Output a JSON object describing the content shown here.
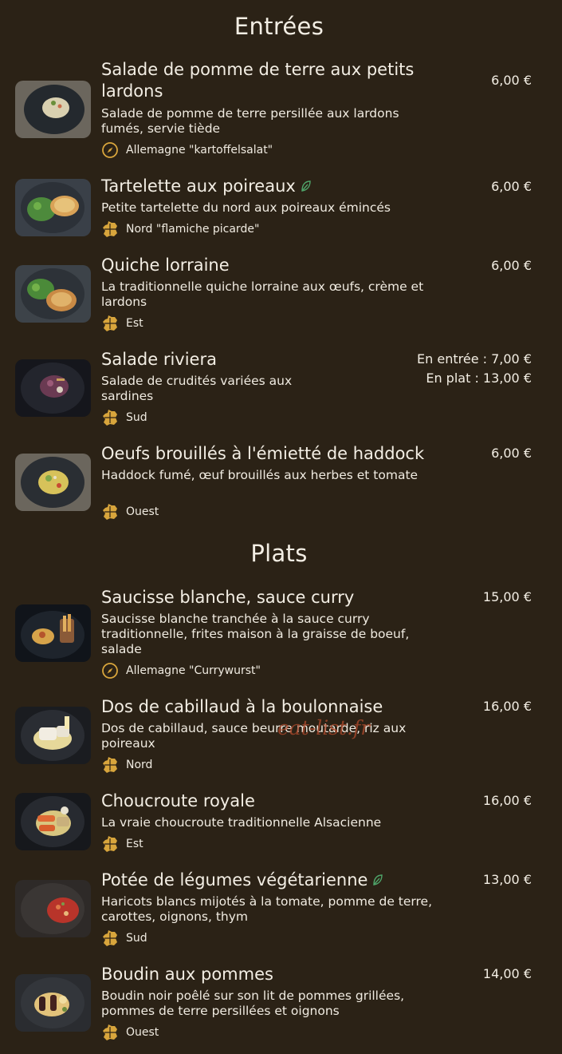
{
  "sections": [
    {
      "title": "Entrées",
      "items": [
        {
          "name": "Salade de pomme de terre aux petits lardons",
          "description": "Salade de pomme de terre persillée aux lardons fumés, servie tiède",
          "origin": "Allemagne \"kartoffelsalat\"",
          "origin_icon": "compass-icon",
          "price": "6,00 €"
        },
        {
          "name": "Tartelette aux poireaux",
          "vegetarian": true,
          "description": "Petite tartelette du nord aux poireaux émincés",
          "origin": "Nord  \"flamiche picarde\"",
          "origin_icon": "france-map-icon",
          "price": "6,00 €"
        },
        {
          "name": "Quiche lorraine",
          "description": "La traditionnelle quiche lorraine aux œufs, crème et lardons",
          "origin": "Est",
          "origin_icon": "france-map-icon",
          "price": "6,00 €"
        },
        {
          "name": "Salade riviera",
          "description": "Salade de crudités variées aux sardines",
          "origin": "Sud",
          "origin_icon": "france-map-icon",
          "prices": [
            "En entrée :  7,00 €",
            "En plat : 13,00 €"
          ]
        },
        {
          "name": "Oeufs brouillés à l'émietté de haddock",
          "description": "Haddock fumé, œuf brouillés aux herbes et tomate",
          "origin": "Ouest",
          "origin_icon": "france-map-icon",
          "price": "6,00 €"
        }
      ]
    },
    {
      "title": "Plats",
      "items": [
        {
          "name": "Saucisse blanche, sauce curry",
          "description": "Saucisse blanche tranchée à la sauce curry traditionnelle, frites maison à la graisse de boeuf, salade",
          "origin": "Allemagne \"Currywurst\"",
          "origin_icon": "compass-icon",
          "price": "15,00 €"
        },
        {
          "name": "Dos de cabillaud à la boulonnaise",
          "description": "Dos de cabillaud, sauce beurre moutarde, riz aux poireaux",
          "origin": "Nord",
          "origin_icon": "france-map-icon",
          "price": "16,00 €"
        },
        {
          "name": "Choucroute royale",
          "description": "La vraie choucroute traditionnelle Alsacienne",
          "origin": "Est",
          "origin_icon": "france-map-icon",
          "price": "16,00 €"
        },
        {
          "name": "Potée de légumes végétarienne",
          "vegetarian": true,
          "description": "Haricots blancs mijotés à la tomate, pomme de terre, carottes, oignons, thym",
          "origin": "Sud",
          "origin_icon": "france-map-icon",
          "price": "13,00 €"
        },
        {
          "name": "Boudin aux pommes",
          "description": "Boudin noir poêlé sur son lit de pommes grillées, pommes de terre persillées et oignons",
          "origin": "Ouest",
          "origin_icon": "france-map-icon",
          "price": "14,00 €"
        }
      ]
    }
  ],
  "watermark": "eat-list.fr",
  "colors": {
    "background": "#2b2216",
    "text": "#f3eee4",
    "icon_gold": "#d8a53c",
    "leaf_green": "#4fa56a",
    "watermark": "#b14a2c"
  }
}
